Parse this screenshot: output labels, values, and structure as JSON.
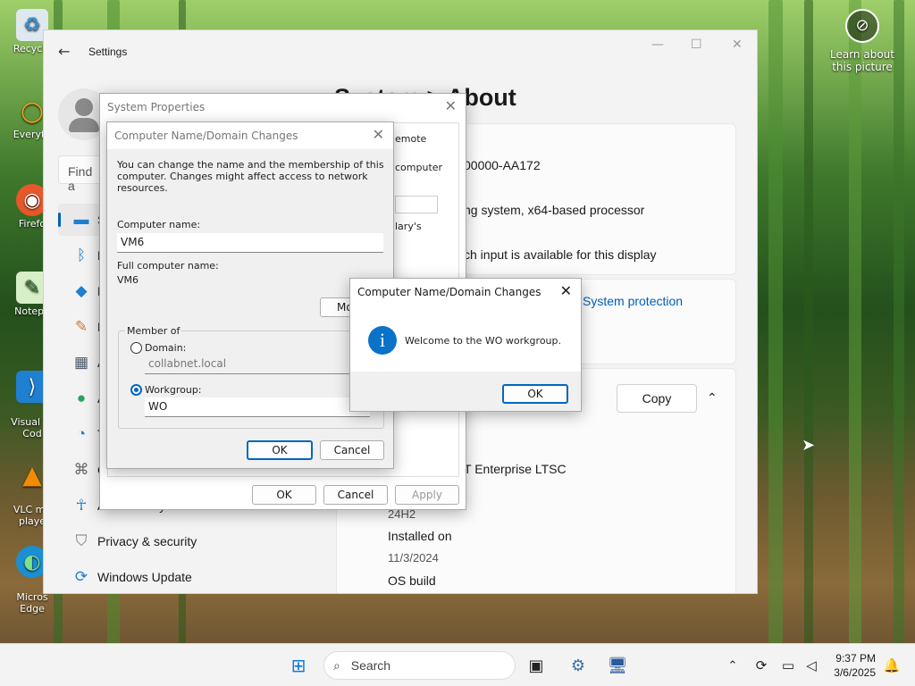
{
  "desktop": {
    "icons": [
      {
        "label": "Recycle",
        "glyph": "♻"
      },
      {
        "label": "Everyth",
        "glyph": "○"
      },
      {
        "label": "Firefo",
        "glyph": "🦊"
      },
      {
        "label": "Notepa",
        "glyph": "📝"
      },
      {
        "label": "Visual St\nCod",
        "glyph": "⟩"
      },
      {
        "label": "VLC me\nplaye",
        "glyph": "▲"
      },
      {
        "label": "Micros\nEdge",
        "glyph": "◐"
      }
    ],
    "learn_label": "Learn about this picture"
  },
  "settings": {
    "title": "Settings",
    "find_placeholder": "Find a",
    "page_title": "System  >  About",
    "nav": [
      {
        "label": "S",
        "icon": "display-icon"
      },
      {
        "label": "B",
        "icon": "bluetooth-icon"
      },
      {
        "label": "N",
        "icon": "wifi-icon"
      },
      {
        "label": "P",
        "icon": "brush-icon"
      },
      {
        "label": "A",
        "icon": "apps-icon"
      },
      {
        "label": "A",
        "icon": "accounts-icon"
      },
      {
        "label": "T",
        "icon": "time-icon"
      },
      {
        "label": "G",
        "icon": "gaming-icon"
      },
      {
        "label": "Accessibility",
        "icon": "accessibility-icon"
      },
      {
        "label": "Privacy & security",
        "icon": "shield-icon"
      },
      {
        "label": "Windows Update",
        "icon": "update-icon"
      }
    ],
    "device": {
      "product_id_partial": "00000-AA172",
      "system_type_partial": "ng system, x64-based processor",
      "pen_partial": "ch input is available for this display",
      "system_protection": "System protection",
      "copy_label": "Copy",
      "edition_partial": "T Enterprise LTSC",
      "version": "24H2",
      "installed_label": "Installed on",
      "installed_value": "11/3/2024",
      "os_build_label": "OS build"
    }
  },
  "sysprops": {
    "title": "System Properties",
    "remote_partial": "emote",
    "computer_partial": "computer",
    "ary_partial": "lary's",
    "ok": "OK",
    "cancel": "Cancel",
    "apply": "Apply"
  },
  "namechange": {
    "title": "Computer Name/Domain Changes",
    "description": "You can change the name and the membership of this computer. Changes might affect access to network resources.",
    "computer_name_label": "Computer name:",
    "computer_name_value": "VM6",
    "full_name_label": "Full computer name:",
    "full_name_value": "VM6",
    "more_partial": "Mo",
    "member_of": "Member of",
    "domain_label": "Domain:",
    "domain_value": "collabnet.local",
    "workgroup_label": "Workgroup:",
    "workgroup_value": "WO",
    "ok": "OK",
    "cancel": "Cancel"
  },
  "welcome": {
    "title": "Computer Name/Domain Changes",
    "message": "Welcome to the WO workgroup.",
    "ok": "OK"
  },
  "taskbar": {
    "search_placeholder": "Search",
    "time": "9:37 PM",
    "date": "3/6/2025"
  },
  "colors": {
    "accent": "#0067c0",
    "link": "#005fb8"
  }
}
